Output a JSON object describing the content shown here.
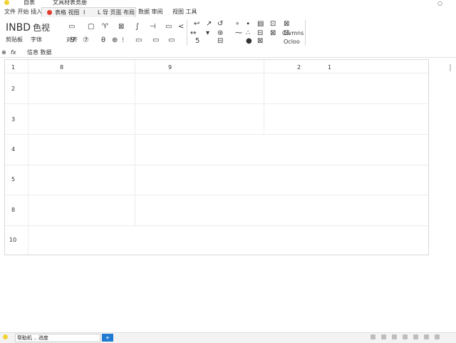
{
  "titlebar": {
    "text_left": "自表",
    "text_main": "文具材表务册",
    "close_glyph": "○"
  },
  "tabs": {
    "tab1": "文件 开始 插入",
    "active": "表格 视图",
    "active_mid": "I",
    "active_right": "L 导 页面 布局",
    "tab3": "数据 审阅",
    "tab4": "视图 工具"
  },
  "ribbon": {
    "big_left": "INBD",
    "big_left2": "色视",
    "sub1": "剪贴板",
    "sub2": "字体",
    "sub3": "对齐",
    "icons_row1": [
      "▭",
      "▢",
      "♈",
      "⊠",
      "∫",
      "⊣",
      "▭",
      "<"
    ],
    "icons_row2": [
      "9",
      "⑦",
      "θ",
      "⊕",
      "⁝",
      "▭",
      "▭",
      "▭"
    ],
    "icons_mid_row1": [
      "↩",
      "↗",
      "↺",
      "∘",
      "∙",
      "▤",
      "⊡",
      "⊠"
    ],
    "icons_mid_row2": [
      "↔",
      "▾",
      "⊛",
      "⁓",
      "∴",
      "⊟",
      "⊠",
      "⊡"
    ],
    "icons_mid_row3": [
      "5",
      "⊟",
      "●",
      "⊠"
    ],
    "right_label1": "Olvmns",
    "right_label2": "Ocloo",
    "right_icon": "⊞"
  },
  "formulabar": {
    "cell_ref": "⊕",
    "fx": "fx",
    "value": "信息 数据"
  },
  "sheet": {
    "column_headers": [
      "1",
      "8",
      "9",
      "2",
      "1"
    ],
    "row_numbers": [
      "2",
      "3",
      "4",
      "5",
      "8",
      "10"
    ]
  },
  "statusbar": {
    "input_text": "帮助机 .. 进度",
    "button_label": "+"
  },
  "colors": {
    "accent": "#1f7ad1",
    "red_dot": "#e33b2e",
    "yellow": "#f2d335"
  }
}
